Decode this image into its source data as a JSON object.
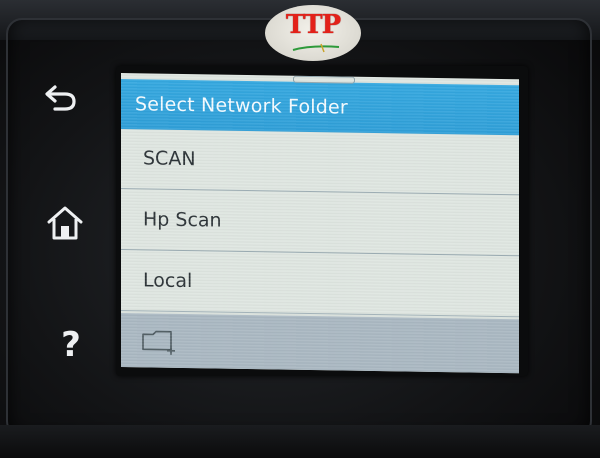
{
  "logo": {
    "text": "TTP"
  },
  "side_buttons": {
    "back": {
      "icon": "back-arrow-icon"
    },
    "home": {
      "icon": "home-icon"
    },
    "help": {
      "icon": "help-icon",
      "glyph": "?"
    }
  },
  "screen": {
    "title": "Select Network Folder",
    "items": [
      {
        "label": "SCAN"
      },
      {
        "label": "Hp Scan"
      },
      {
        "label": "Local"
      }
    ],
    "footer": {
      "icon": "add-folder-icon"
    }
  },
  "colors": {
    "header": "#34a8e0",
    "list_background": "#dfe6e1",
    "footer": "#aab8c2",
    "logo_red": "#e32119"
  }
}
